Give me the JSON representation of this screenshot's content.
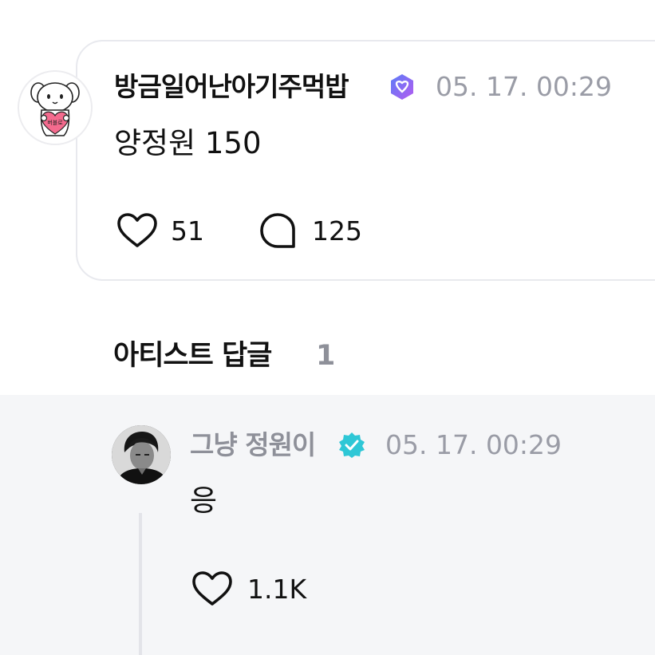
{
  "comment": {
    "username": "방금일어난아기주먹밥",
    "badge_icon": "fan-verified-heart-badge-icon",
    "timestamp": "05. 17. 00:29",
    "text": "양정원 150",
    "likes": "51",
    "replies": "125",
    "avatar_icon": "puppy-holding-heart-avatar",
    "avatar_heart_text": "버블로"
  },
  "artist_replies": {
    "title": "아티스트 답글",
    "count": "1",
    "items": [
      {
        "name": "그냥 정원이",
        "badge_icon": "artist-verified-badge-icon",
        "timestamp": "05. 17. 00:29",
        "text": "응",
        "likes": "1.1K"
      }
    ]
  },
  "colors": {
    "text_primary": "#111111",
    "text_muted": "#9a9ca6",
    "card_border": "#e8e9ee",
    "reply_bg": "#f5f6f8",
    "fan_badge_gradient": [
      "#5b7cf7",
      "#b45cf0"
    ],
    "artist_badge": "#2ec7d6",
    "heart_pink": "#f46b8e"
  }
}
